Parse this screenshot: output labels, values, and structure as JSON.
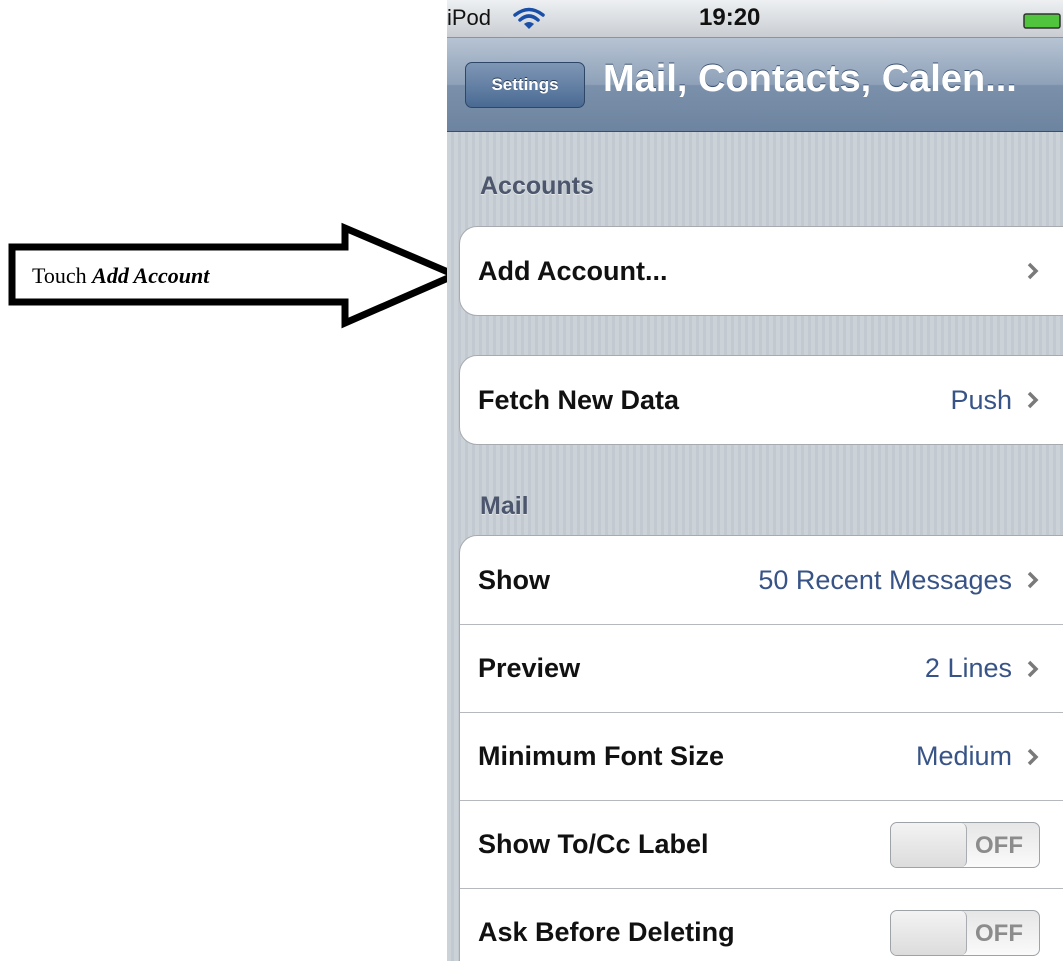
{
  "annotation": {
    "prefix": "Touch",
    "emphasis": "Add Account"
  },
  "status_bar": {
    "carrier": "iPod",
    "time": "19:20"
  },
  "nav_bar": {
    "back_label": "Settings",
    "title": "Mail, Contacts, Calen..."
  },
  "sections": {
    "accounts_header": "Accounts",
    "mail_header": "Mail"
  },
  "rows": {
    "add_account": {
      "label": "Add Account..."
    },
    "fetch_new_data": {
      "label": "Fetch New Data",
      "value": "Push"
    },
    "show": {
      "label": "Show",
      "value": "50 Recent Messages"
    },
    "preview": {
      "label": "Preview",
      "value": "2 Lines"
    },
    "min_font_size": {
      "label": "Minimum Font Size",
      "value": "Medium"
    },
    "show_to_cc": {
      "label": "Show To/Cc Label",
      "state": "OFF"
    },
    "ask_before_deleting": {
      "label": "Ask Before Deleting",
      "state": "OFF"
    }
  },
  "colors": {
    "value_text": "#385487",
    "nav_bar": "#7b90aa",
    "section_header": "#4c566c"
  }
}
